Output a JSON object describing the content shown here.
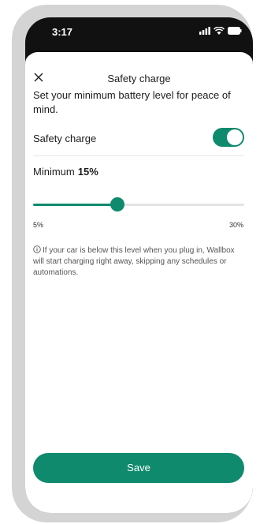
{
  "status_bar": {
    "time": "3:17"
  },
  "header": {
    "title": "Safety charge"
  },
  "intro": "Set your minimum battery level for peace of mind.",
  "safety_toggle": {
    "label": "Safety charge",
    "on": true
  },
  "minimum": {
    "label": "Minimum",
    "value_text": "15%",
    "value": 15
  },
  "slider": {
    "min_label": "5%",
    "max_label": "30%",
    "min": 5,
    "max": 30,
    "value": 15
  },
  "info": "If your car is below this level when you plug in, Wallbox will start charging right away, skipping any schedules or automations.",
  "footer": {
    "save_label": "Save"
  },
  "colors": {
    "accent": "#0f8a6d",
    "frame": "#d4d4d4",
    "track": "#e4e4e4"
  },
  "icons": [
    "close-icon",
    "signal-icon",
    "wifi-icon",
    "battery-icon",
    "info-icon"
  ]
}
